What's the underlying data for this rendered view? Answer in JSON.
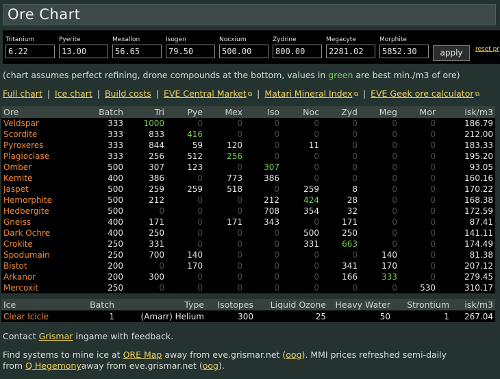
{
  "page": {
    "title": "Ore Chart"
  },
  "prices": {
    "fields": [
      {
        "label": "Tritanium",
        "value": "6.22"
      },
      {
        "label": "Pyerite",
        "value": "13.00"
      },
      {
        "label": "Mexallon",
        "value": "56.65"
      },
      {
        "label": "Isogen",
        "value": "79.50"
      },
      {
        "label": "Nocxium",
        "value": "500.00"
      },
      {
        "label": "Zydrine",
        "value": "800.00"
      },
      {
        "label": "Megacyte",
        "value": "2281.02"
      },
      {
        "label": "Morphite",
        "value": "5852.30"
      }
    ],
    "apply_label": "apply",
    "reset_label": "reset pr"
  },
  "note": {
    "before": "(chart assumes perfect refining, drone compounds at the bottom, values in ",
    "green_word": "green",
    "after": " are best min./m3 of ore)"
  },
  "links": {
    "full_chart": "Full chart",
    "ice_chart": "Ice chart",
    "build_costs": "Build costs",
    "eve_central": "EVE Central Market",
    "matari": "Matari Mineral Index",
    "eve_geek": "EVE Geek ore calculator",
    "separator": "|"
  },
  "ore_table": {
    "headers": [
      "Ore",
      "Batch",
      "Tri",
      "Pye",
      "Mex",
      "Iso",
      "Noc",
      "Zyd",
      "Meg",
      "Mor",
      "isk/m3"
    ],
    "rows": [
      {
        "name": "Veldspar",
        "values": [
          "333",
          "1000",
          "0",
          "0",
          "0",
          "0",
          "0",
          "0",
          "0",
          "186.79"
        ],
        "best": [
          1
        ]
      },
      {
        "name": "Scordite",
        "values": [
          "333",
          "833",
          "416",
          "0",
          "0",
          "0",
          "0",
          "0",
          "0",
          "212.00"
        ],
        "best": [
          2
        ]
      },
      {
        "name": "Pyroxeres",
        "values": [
          "333",
          "844",
          "59",
          "120",
          "0",
          "11",
          "0",
          "0",
          "0",
          "183.33"
        ],
        "best": []
      },
      {
        "name": "Plagioclase",
        "values": [
          "333",
          "256",
          "512",
          "256",
          "0",
          "0",
          "0",
          "0",
          "0",
          "195.20"
        ],
        "best": [
          3
        ]
      },
      {
        "name": "Omber",
        "values": [
          "500",
          "307",
          "123",
          "0",
          "307",
          "0",
          "0",
          "0",
          "0",
          "93.05"
        ],
        "best": [
          4
        ]
      },
      {
        "name": "Kernite",
        "values": [
          "400",
          "386",
          "0",
          "773",
          "386",
          "0",
          "0",
          "0",
          "0",
          "160.16"
        ],
        "best": []
      },
      {
        "name": "Jaspet",
        "values": [
          "500",
          "259",
          "259",
          "518",
          "0",
          "259",
          "8",
          "0",
          "0",
          "170.22"
        ],
        "best": []
      },
      {
        "name": "Hemorphite",
        "values": [
          "500",
          "212",
          "0",
          "0",
          "212",
          "424",
          "28",
          "0",
          "0",
          "168.38"
        ],
        "best": [
          5
        ]
      },
      {
        "name": "Hedbergite",
        "values": [
          "500",
          "0",
          "0",
          "0",
          "708",
          "354",
          "32",
          "0",
          "0",
          "172.59"
        ],
        "best": []
      },
      {
        "name": "Gneiss",
        "values": [
          "400",
          "171",
          "0",
          "171",
          "343",
          "0",
          "171",
          "0",
          "0",
          "87.41"
        ],
        "best": []
      },
      {
        "name": "Dark Ochre",
        "values": [
          "400",
          "250",
          "0",
          "0",
          "0",
          "500",
          "250",
          "0",
          "0",
          "141.11"
        ],
        "best": []
      },
      {
        "name": "Crokite",
        "values": [
          "250",
          "331",
          "0",
          "0",
          "0",
          "331",
          "663",
          "0",
          "0",
          "174.49"
        ],
        "best": [
          6
        ]
      },
      {
        "name": "Spodumain",
        "values": [
          "250",
          "700",
          "140",
          "0",
          "0",
          "0",
          "0",
          "140",
          "0",
          "81.38"
        ],
        "best": []
      },
      {
        "name": "Bistot",
        "values": [
          "200",
          "0",
          "170",
          "0",
          "0",
          "0",
          "341",
          "170",
          "0",
          "207.12"
        ],
        "best": []
      },
      {
        "name": "Arkanor",
        "values": [
          "200",
          "300",
          "0",
          "0",
          "0",
          "0",
          "166",
          "333",
          "0",
          "279.45"
        ],
        "best": [
          7
        ]
      },
      {
        "name": "Mercoxit",
        "values": [
          "250",
          "0",
          "0",
          "0",
          "0",
          "0",
          "0",
          "0",
          "530",
          "310.17"
        ],
        "best": []
      }
    ]
  },
  "ice_table": {
    "headers": [
      "Ice",
      "Batch",
      "Type",
      "Isotopes",
      "Liquid Ozone",
      "Heavy Water",
      "Strontium",
      "isk/m3"
    ],
    "rows": [
      {
        "name": "Clear Icicle",
        "batch": "1",
        "type": "(Amarr) Helium",
        "isotopes": "300",
        "ozone": "25",
        "water": "50",
        "strontium": "1",
        "iskm3": "267.04"
      }
    ]
  },
  "contact": {
    "before": "Contact ",
    "name": "Grismar",
    "after": " ingame with feedback."
  },
  "footer": {
    "t1": "Find systems to mine ice at ",
    "ore_map": "ORE Map",
    "t2": " away from eve.grismar.net (",
    "oog1": "oog",
    "t3": "). MMI prices refreshed semi-daily from ",
    "hegemony": "Q Hegemony",
    "t4": "away from eve.grismar.net (",
    "oog2": "oog",
    "t5": ")."
  },
  "colors": {
    "link": "#f4d35e",
    "ore_name": "#f08a3a",
    "best": "#72d24e",
    "zero": "#4a4f4c"
  }
}
